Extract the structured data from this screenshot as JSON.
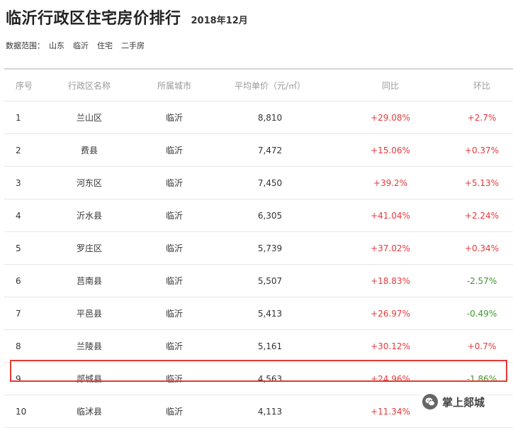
{
  "header": {
    "title": "临沂行政区住宅房价排行",
    "date": "2018年12月"
  },
  "scope": {
    "label": "数据范围：",
    "items": [
      "山东",
      "临沂",
      "住宅",
      "二手房"
    ]
  },
  "table": {
    "columns": [
      "序号",
      "行政区名称",
      "所属城市",
      "平均单价（元/㎡）",
      "同比",
      "环比"
    ],
    "rows": [
      {
        "rank": "1",
        "district": "兰山区",
        "city": "临沂",
        "price": "8,810",
        "yoy": "+29.08%",
        "mom": "+2.7%"
      },
      {
        "rank": "2",
        "district": "费县",
        "city": "临沂",
        "price": "7,472",
        "yoy": "+15.06%",
        "mom": "+0.37%"
      },
      {
        "rank": "3",
        "district": "河东区",
        "city": "临沂",
        "price": "7,450",
        "yoy": "+39.2%",
        "mom": "+5.13%"
      },
      {
        "rank": "4",
        "district": "沂水县",
        "city": "临沂",
        "price": "6,305",
        "yoy": "+41.04%",
        "mom": "+2.24%"
      },
      {
        "rank": "5",
        "district": "罗庄区",
        "city": "临沂",
        "price": "5,739",
        "yoy": "+37.02%",
        "mom": "+0.34%"
      },
      {
        "rank": "6",
        "district": "莒南县",
        "city": "临沂",
        "price": "5,507",
        "yoy": "+18.83%",
        "mom": "-2.57%"
      },
      {
        "rank": "7",
        "district": "平邑县",
        "city": "临沂",
        "price": "5,413",
        "yoy": "+26.97%",
        "mom": "-0.49%"
      },
      {
        "rank": "8",
        "district": "兰陵县",
        "city": "临沂",
        "price": "5,161",
        "yoy": "+30.12%",
        "mom": "+0.7%"
      },
      {
        "rank": "9",
        "district": "郯城县",
        "city": "临沂",
        "price": "4,563",
        "yoy": "+24.96%",
        "mom": "-1.86%"
      },
      {
        "rank": "10",
        "district": "临沭县",
        "city": "临沂",
        "price": "4,113",
        "yoy": "+11.34%",
        "mom": ""
      }
    ]
  },
  "watermark": {
    "text": "掌上郯城",
    "icon": "wechat-icon"
  },
  "colors": {
    "positive": "#e4393c",
    "negative": "#3d9a2a",
    "highlight_border": "#e23b34"
  }
}
